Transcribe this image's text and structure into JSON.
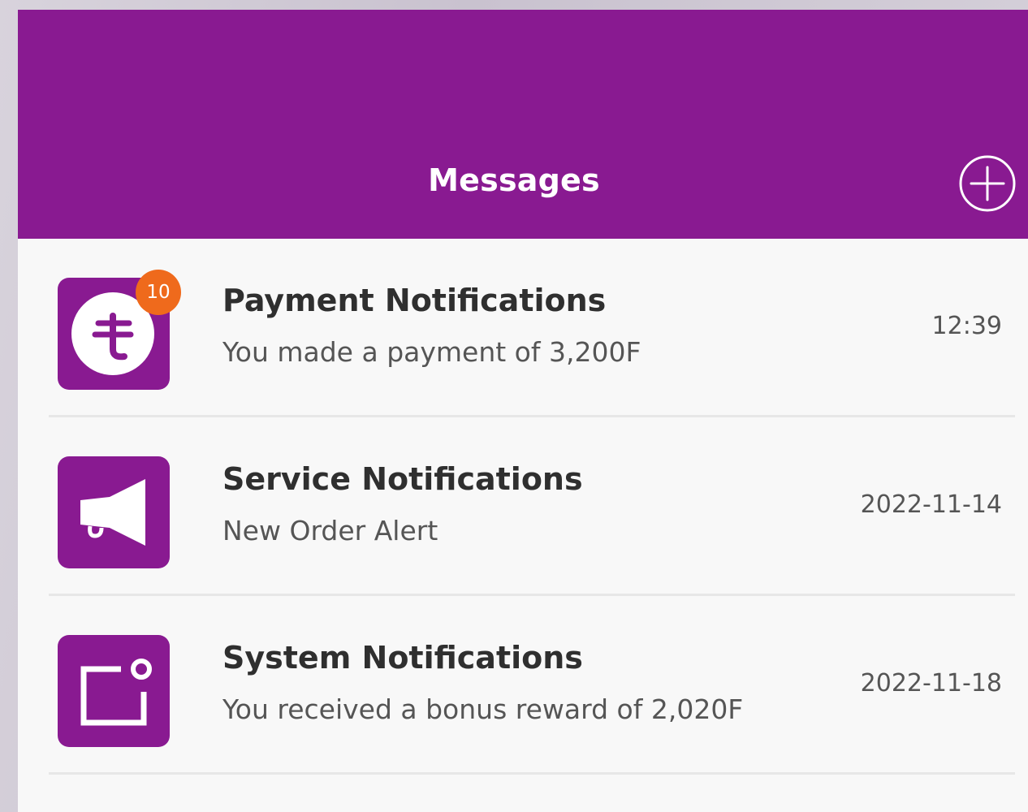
{
  "header": {
    "title": "Messages",
    "add_icon": "plus-circle-icon",
    "background": "#891a91"
  },
  "accent_colors": {
    "brand": "#891a91",
    "badge": "#ef6a1c"
  },
  "notifications": [
    {
      "title": "Payment Notifications",
      "subtitle": "You made a payment of 3,200F",
      "time": "12:39",
      "icon": "currency-icon",
      "badge": "10"
    },
    {
      "title": "Service Notifications",
      "subtitle": "New Order Alert",
      "time": "2022-11-14",
      "icon": "megaphone-icon"
    },
    {
      "title": "System Notifications",
      "subtitle": "You received a bonus reward of 2,020F",
      "time": "2022-11-18",
      "icon": "notification-square-icon"
    }
  ]
}
